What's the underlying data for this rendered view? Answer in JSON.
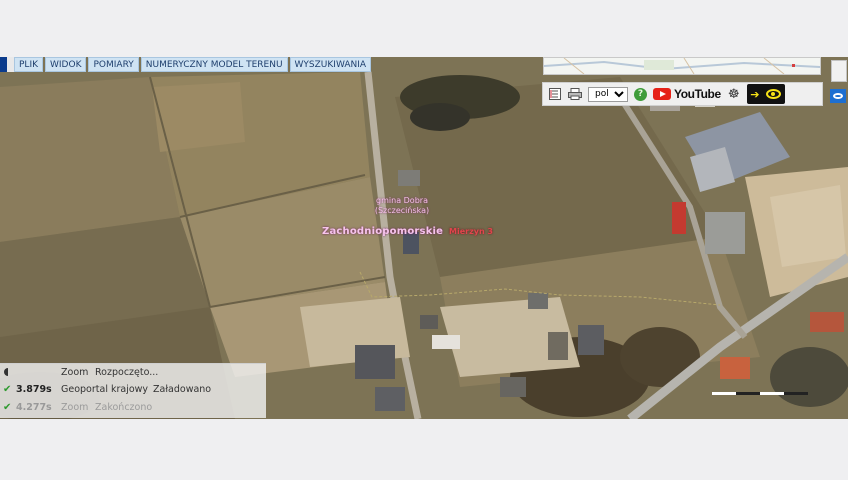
{
  "menu": {
    "items": [
      "PLIK",
      "WIDOK",
      "POMIARY",
      "NUMERYCZNY MODEL TERENU",
      "WYSZUKIWANIA"
    ]
  },
  "toolbar": {
    "language": "pol",
    "language_options": [
      "pol"
    ],
    "help_label": "?",
    "youtube_label": "YouTube"
  },
  "map_labels": {
    "gmina": "gmina Dobra (Szczecińska)",
    "wojewodztwo": "Zachodniopomorskie",
    "miejscowosc": "Mierzyn 3"
  },
  "status": {
    "rows": [
      {
        "time": "",
        "name": "Zoom",
        "state": "Rozpoczęto..."
      },
      {
        "time": "3.879s",
        "name": "Geoportal krajowy",
        "state": "Załadowano"
      },
      {
        "time": "4.277s",
        "name": "Zoom",
        "state": "Zakończono"
      }
    ]
  },
  "colors": {
    "menu_bg": "#cfe3f3",
    "label_pink": "#f4bfe8",
    "label_red": "#e0454c",
    "ok_green": "#2f9a2f"
  }
}
